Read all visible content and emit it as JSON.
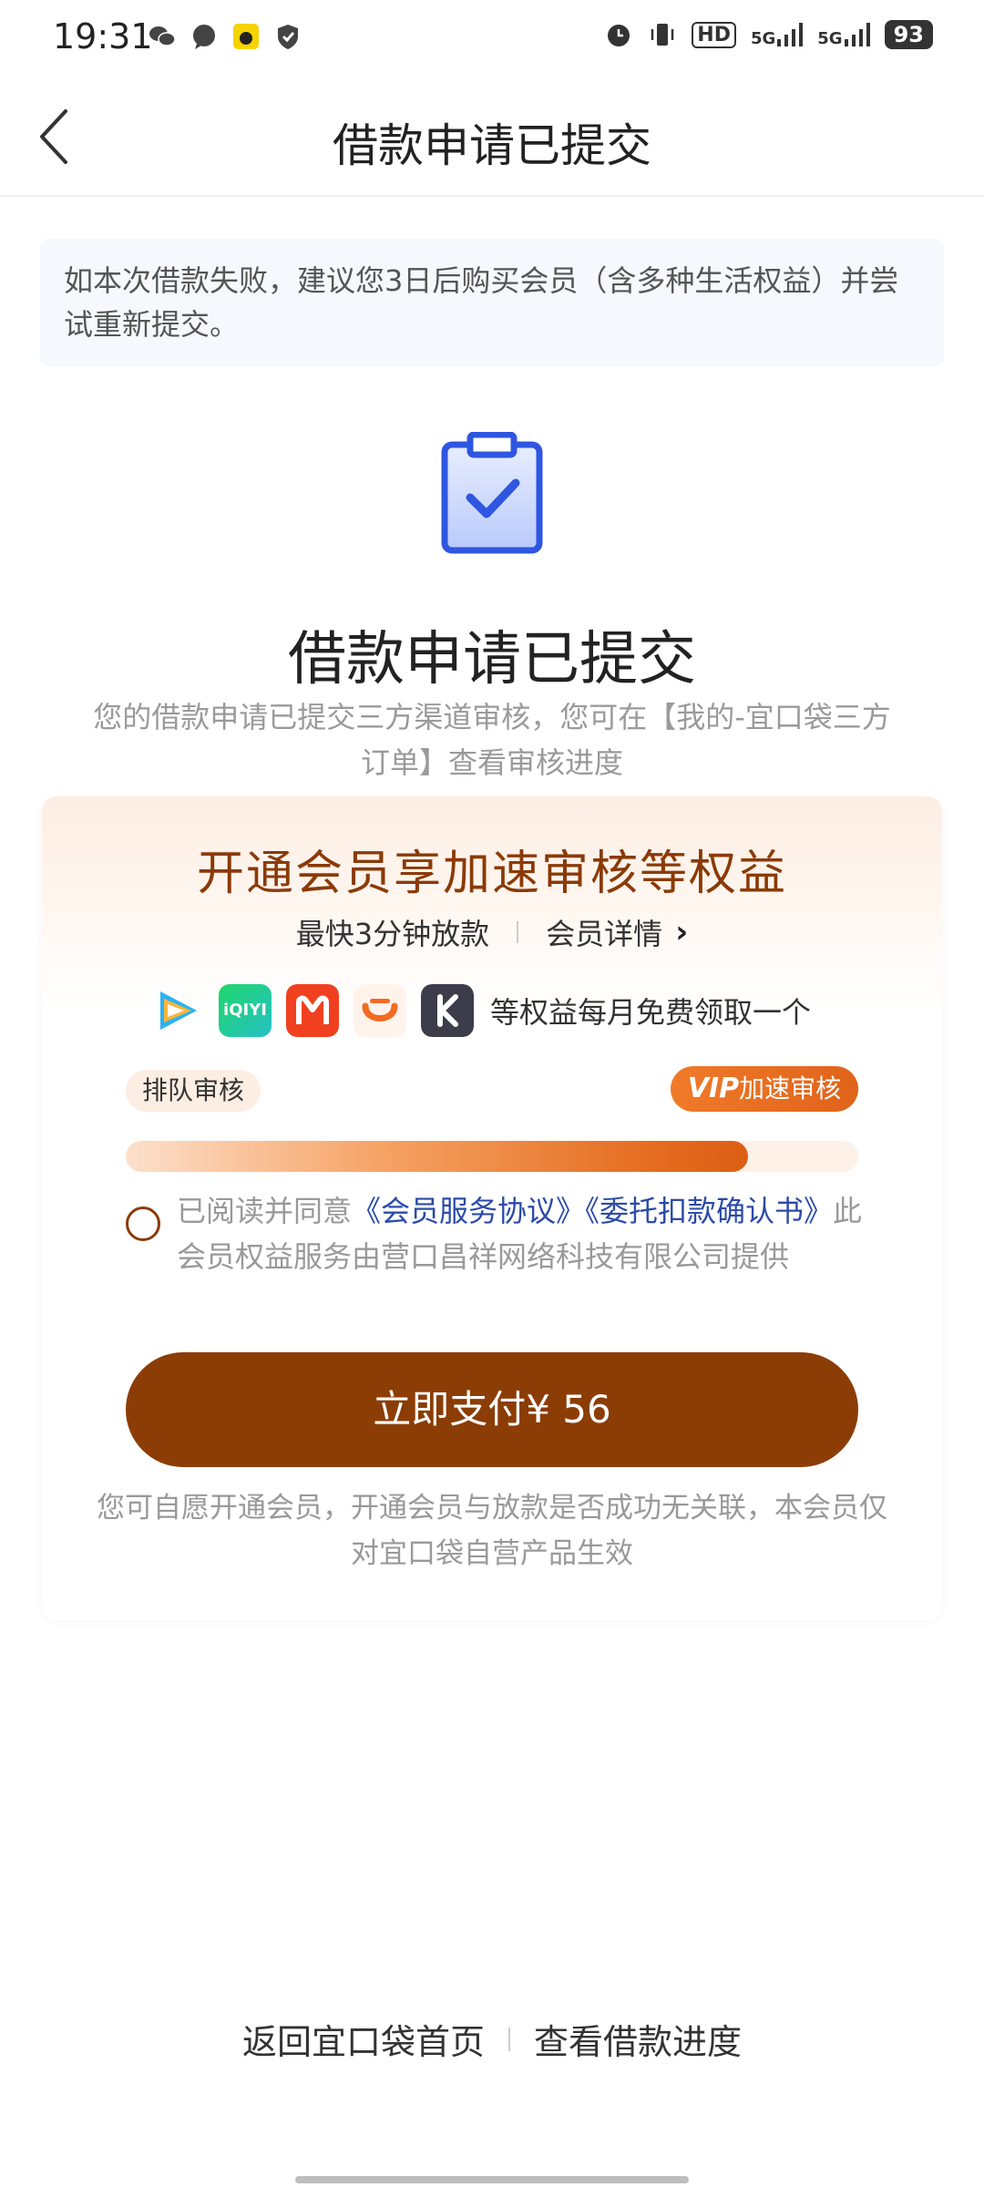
{
  "status_bar": {
    "time": "19:31",
    "network1": "5G",
    "network2": "5G",
    "hd_label": "HD",
    "battery": "93"
  },
  "nav": {
    "title": "借款申请已提交"
  },
  "notice": {
    "text": "如本次借款失败，建议您3日后购买会员（含多种生活权益）并尝试重新提交。"
  },
  "main": {
    "title": "借款申请已提交",
    "description": "您的借款申请已提交三方渠道审核，您可在【我的-宜口袋三方订单】查看审核进度"
  },
  "member_card": {
    "title": "开通会员享加速审核等权益",
    "subtitle_left": "最快3分钟放款",
    "subtitle_right": "会员详情",
    "benefit_icons": [
      "tencent-video-icon",
      "iqiyi-icon",
      "mango-tv-icon",
      "didi-icon",
      "kuaikan-icon"
    ],
    "iqiyi_label": "iQIYI",
    "benefits_text": "等权益每月免费领取一个",
    "queue_label": "排队审核",
    "vip_label_prefix": "VIP",
    "vip_label": "加速审核",
    "progress_value": 0.85,
    "agreement_prefix": "已阅读并同意",
    "agreement_link1": "《会员服务协议》",
    "agreement_link2": "《委托扣款确认书》",
    "agreement_suffix": "此会员权益服务由营口昌祥网络科技有限公司提供",
    "pay_button": "立即支付¥ 56",
    "note": "您可自愿开通会员，开通会员与放款是否成功无关联，本会员仅对宜口袋自营产品生效"
  },
  "footer": {
    "link_home": "返回宜口袋首页",
    "link_progress": "查看借款进度"
  },
  "colors": {
    "brand_brown": "#8b3d05",
    "accent_orange": "#e0631a",
    "link_blue": "#2b4ba8",
    "icon_blue": "#2f56e0"
  }
}
